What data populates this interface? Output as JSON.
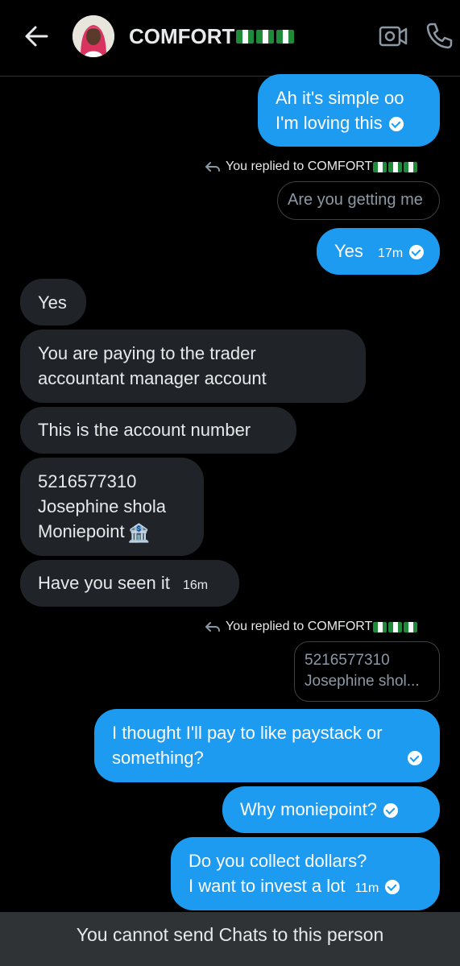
{
  "header": {
    "title": "COMFORT",
    "flag_icons": [
      "nigeria-flag",
      "nigeria-flag",
      "nigeria-flag"
    ],
    "icons": [
      "back-arrow-icon",
      "video-call-icon",
      "phone-icon"
    ]
  },
  "messages": [
    {
      "side": "sent",
      "lines": [
        "Ah it's simple oo",
        "I'm loving this"
      ],
      "time": "",
      "seen": true
    },
    {
      "replied_label": "You replied to COMFORT",
      "quote": "Are you getting me"
    },
    {
      "side": "sent",
      "lines": [
        "Yes"
      ],
      "time": "17m",
      "seen": true
    },
    {
      "side": "received",
      "lines": [
        "Yes"
      ]
    },
    {
      "side": "received",
      "lines": [
        "You are paying to the trader",
        "accountant manager account"
      ]
    },
    {
      "side": "received",
      "lines": [
        "This is the account number"
      ]
    },
    {
      "side": "received",
      "lines": [
        "5216577310",
        "Josephine shola",
        "Moniepoint"
      ],
      "emoji": "🏦"
    },
    {
      "side": "received",
      "lines": [
        "Have you seen it"
      ],
      "time": "16m"
    },
    {
      "replied_label": "You replied to COMFORT",
      "quote_lines": [
        "5216577310",
        "Josephine shol..."
      ]
    },
    {
      "side": "sent",
      "lines": [
        "I thought I'll pay to like paystack or",
        "something?"
      ],
      "seen": true
    },
    {
      "side": "sent",
      "lines": [
        "Why moniepoint?"
      ],
      "seen": true
    },
    {
      "side": "sent",
      "lines": [
        "Do you collect dollars?",
        "I want to invest a lot"
      ],
      "time": "11m",
      "seen": true
    }
  ],
  "footer": {
    "notice": "You cannot send Chats to this person"
  },
  "colors": {
    "sent_bubble": "#1d9bf0",
    "received_bubble": "#202327",
    "background": "#000000",
    "footer_bar": "#2f3336"
  }
}
